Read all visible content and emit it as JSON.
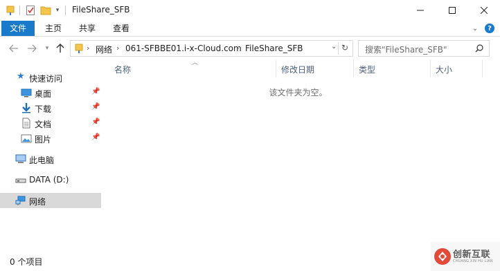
{
  "window": {
    "title": "FileShare_SFB",
    "minimize_icon": "minimize-icon",
    "maximize_icon": "maximize-icon",
    "close_icon": "close-icon"
  },
  "ribbon": {
    "tabs": [
      {
        "label": "文件",
        "active": true
      },
      {
        "label": "主页"
      },
      {
        "label": "共享"
      },
      {
        "label": "查看"
      }
    ]
  },
  "address": {
    "breadcrumbs": [
      "网络",
      "061-SFBBE01.i-x-Cloud.com",
      "FileShare_SFB"
    ]
  },
  "search": {
    "placeholder": "搜索\"FileShare_SFB\""
  },
  "nav": {
    "quick_access": "快速访问",
    "items": [
      {
        "label": "桌面",
        "pinned": true
      },
      {
        "label": "下载",
        "pinned": true
      },
      {
        "label": "文档",
        "pinned": true
      },
      {
        "label": "图片",
        "pinned": true
      }
    ],
    "this_pc": "此电脑",
    "drive": "DATA (D:)",
    "network": "网络"
  },
  "columns": [
    "名称",
    "修改日期",
    "类型",
    "大小"
  ],
  "empty_message": "该文件夹为空。",
  "status": {
    "item_count": "0 个项目"
  },
  "watermark": {
    "text": "创新互联",
    "sub": "CHUANG XIN HU LIAN"
  },
  "colors": {
    "accent": "#1979ca",
    "selected_bg": "#d9d9d9",
    "header_text": "#4c607a"
  }
}
